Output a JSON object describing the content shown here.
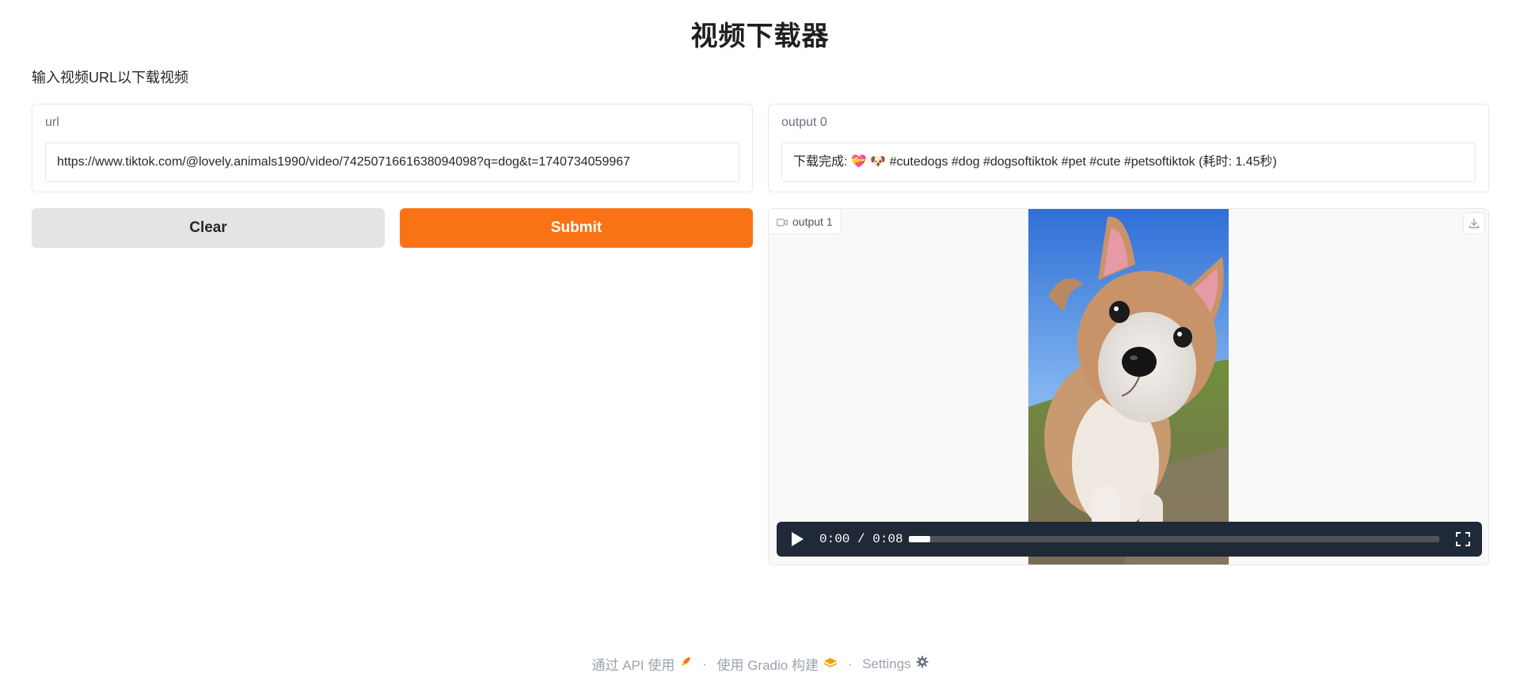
{
  "header": {
    "title": "视频下载器",
    "description": "输入视频URL以下载视频"
  },
  "input_panel": {
    "label": "url",
    "value": "https://www.tiktok.com/@lovely.animals1990/video/7425071661638094098?q=dog&t=1740734059967"
  },
  "buttons": {
    "clear_label": "Clear",
    "submit_label": "Submit"
  },
  "output0": {
    "label": "output 0",
    "value": "下载完成: 💝 🐶 #cutedogs #dog #dogsoftiktok #pet #cute #petsoftiktok  (耗时: 1.45秒)"
  },
  "output1": {
    "label": "output 1",
    "time_display": "0:00 / 0:08",
    "progress": 0.04
  },
  "footer": {
    "api_label": "通过 API 使用",
    "gradio_label": "使用 Gradio 构建",
    "settings_label": "Settings",
    "separator": "·"
  },
  "colors": {
    "accent": "#f97316",
    "secondary_button": "#e4e4e7",
    "video_controls": "#1f2937"
  }
}
